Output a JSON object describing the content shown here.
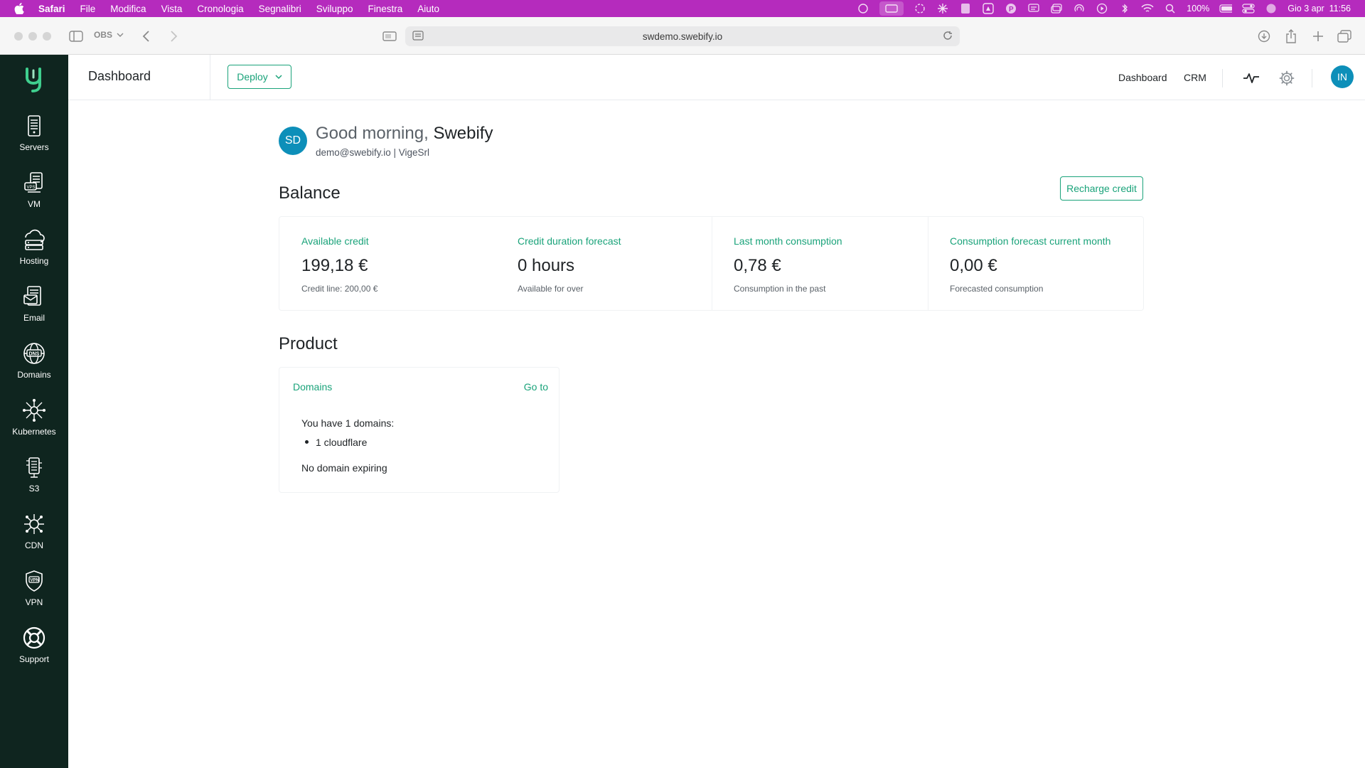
{
  "menubar": {
    "app": "Safari",
    "items": [
      "File",
      "Modifica",
      "Vista",
      "Cronologia",
      "Segnalibri",
      "Sviluppo",
      "Finestra",
      "Aiuto"
    ],
    "battery": "100%",
    "datetime": "Gio 3 apr  11:56"
  },
  "browser": {
    "profile": "OBS",
    "url": "swdemo.swebify.io"
  },
  "sidebar": {
    "items": [
      {
        "label": "Servers",
        "icon": "server-icon"
      },
      {
        "label": "VM",
        "icon": "vm-icon"
      },
      {
        "label": "Hosting",
        "icon": "hosting-icon"
      },
      {
        "label": "Email",
        "icon": "email-icon"
      },
      {
        "label": "Domains",
        "icon": "dns-globe-icon"
      },
      {
        "label": "Kubernetes",
        "icon": "kubernetes-icon"
      },
      {
        "label": "S3",
        "icon": "s3-icon"
      },
      {
        "label": "CDN",
        "icon": "cdn-icon"
      },
      {
        "label": "VPN",
        "icon": "vpn-shield-icon"
      },
      {
        "label": "Support",
        "icon": "support-lifebuoy-icon"
      }
    ]
  },
  "header": {
    "title": "Dashboard",
    "deploy_label": "Deploy",
    "nav_dashboard": "Dashboard",
    "nav_crm": "CRM",
    "user_initials": "IN"
  },
  "greeting": {
    "initials": "SD",
    "prefix": "Good morning,",
    "name": "Swebify",
    "subline": "demo@swebify.io | VigeSrl"
  },
  "balance": {
    "title": "Balance",
    "recharge_label": "Recharge credit",
    "cards": [
      {
        "label": "Available credit",
        "value": "199,18 €",
        "note": "Credit line: 200,00 €"
      },
      {
        "label": "Credit duration forecast",
        "value": "0 hours",
        "note": "Available for over"
      },
      {
        "label": "Last month consumption",
        "value": "0,78 €",
        "note": "Consumption in the past"
      },
      {
        "label": "Consumption forecast current month",
        "value": "0,00 €",
        "note": "Forecasted consumption"
      }
    ]
  },
  "product": {
    "title": "Product",
    "card_title": "Domains",
    "goto_label": "Go to",
    "summary": "You have 1 domains:",
    "bullet": "1 cloudflare",
    "expiring": "No domain expiring"
  },
  "colors": {
    "accent": "#1aa37a",
    "sidebar_bg": "#0f251f",
    "menubar_bg": "#b52bbd",
    "avatar_bg": "#0d8fb9"
  }
}
